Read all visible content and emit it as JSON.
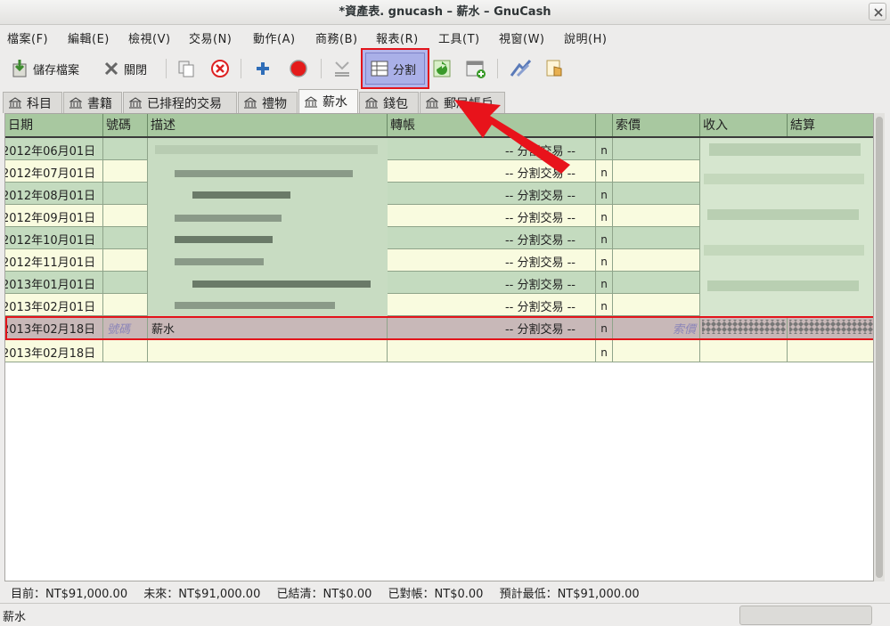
{
  "window": {
    "title": "*資產表. gnucash – 薪水  –  GnuCash"
  },
  "menu": [
    {
      "label": "檔案(F)"
    },
    {
      "label": "編輯(E)"
    },
    {
      "label": "檢視(V)"
    },
    {
      "label": "交易(N)"
    },
    {
      "label": "動作(A)"
    },
    {
      "label": "商務(B)"
    },
    {
      "label": "報表(R)"
    },
    {
      "label": "工具(T)"
    },
    {
      "label": "視窗(W)"
    },
    {
      "label": "說明(H)"
    }
  ],
  "toolbar": {
    "save_label": "儲存檔案",
    "close_label": "關閉",
    "split_label": "分割"
  },
  "tabs": [
    {
      "label": "科目"
    },
    {
      "label": "書籍"
    },
    {
      "label": "已排程的交易"
    },
    {
      "label": "禮物"
    },
    {
      "label": "薪水"
    },
    {
      "label": "錢包"
    },
    {
      "label": "郵局帳戶"
    }
  ],
  "register": {
    "columns": {
      "date": "日期",
      "num": "號碼",
      "desc": "描述",
      "transfer": "轉帳",
      "rec": "",
      "price": "索價",
      "income": "收入",
      "balance": "結算"
    },
    "rows": [
      {
        "date": "2012年06月01日",
        "transfer": "-- 分割交易 --",
        "rec": "n"
      },
      {
        "date": "2012年07月01日",
        "transfer": "-- 分割交易 --",
        "rec": "n"
      },
      {
        "date": "2012年08月01日",
        "transfer": "-- 分割交易 --",
        "rec": "n"
      },
      {
        "date": "2012年09月01日",
        "transfer": "-- 分割交易 --",
        "rec": "n"
      },
      {
        "date": "2012年10月01日",
        "transfer": "-- 分割交易 --",
        "rec": "n"
      },
      {
        "date": "2012年11月01日",
        "transfer": "-- 分割交易 --",
        "rec": "n"
      },
      {
        "date": "2013年01月01日",
        "transfer": "-- 分割交易 --",
        "rec": "n"
      },
      {
        "date": "2013年02月01日",
        "transfer": "-- 分割交易 --",
        "rec": "n"
      }
    ],
    "selected": {
      "date": "2013年02月18日",
      "num_placeholder": "號碼",
      "desc": "薪水",
      "transfer": "-- 分割交易 --",
      "rec": "n",
      "price_placeholder": "索價"
    },
    "blank": {
      "date": "2013年02月18日",
      "rec": "n"
    }
  },
  "summary": [
    {
      "text": "目前：NT$91,000.00"
    },
    {
      "text": "未來：NT$91,000.00"
    },
    {
      "text": "已結清：NT$0.00"
    },
    {
      "text": "已對帳：NT$0.00"
    },
    {
      "text": "預計最低：NT$91,000.00"
    }
  ],
  "status": {
    "text": "薪水"
  },
  "colors": {
    "header_bg": "#a8c8a0",
    "row_green": "#c4dbbf",
    "row_yellow": "#f9fbdf",
    "highlight": "#e3141b"
  },
  "icons": [
    "save-icon",
    "close-x-icon",
    "duplicate-icon",
    "delete-icon",
    "new-transaction-icon",
    "record-icon",
    "cancel-icon",
    "split-icon",
    "jump-icon",
    "schedule-icon",
    "edit-account-icon",
    "account-icon"
  ]
}
